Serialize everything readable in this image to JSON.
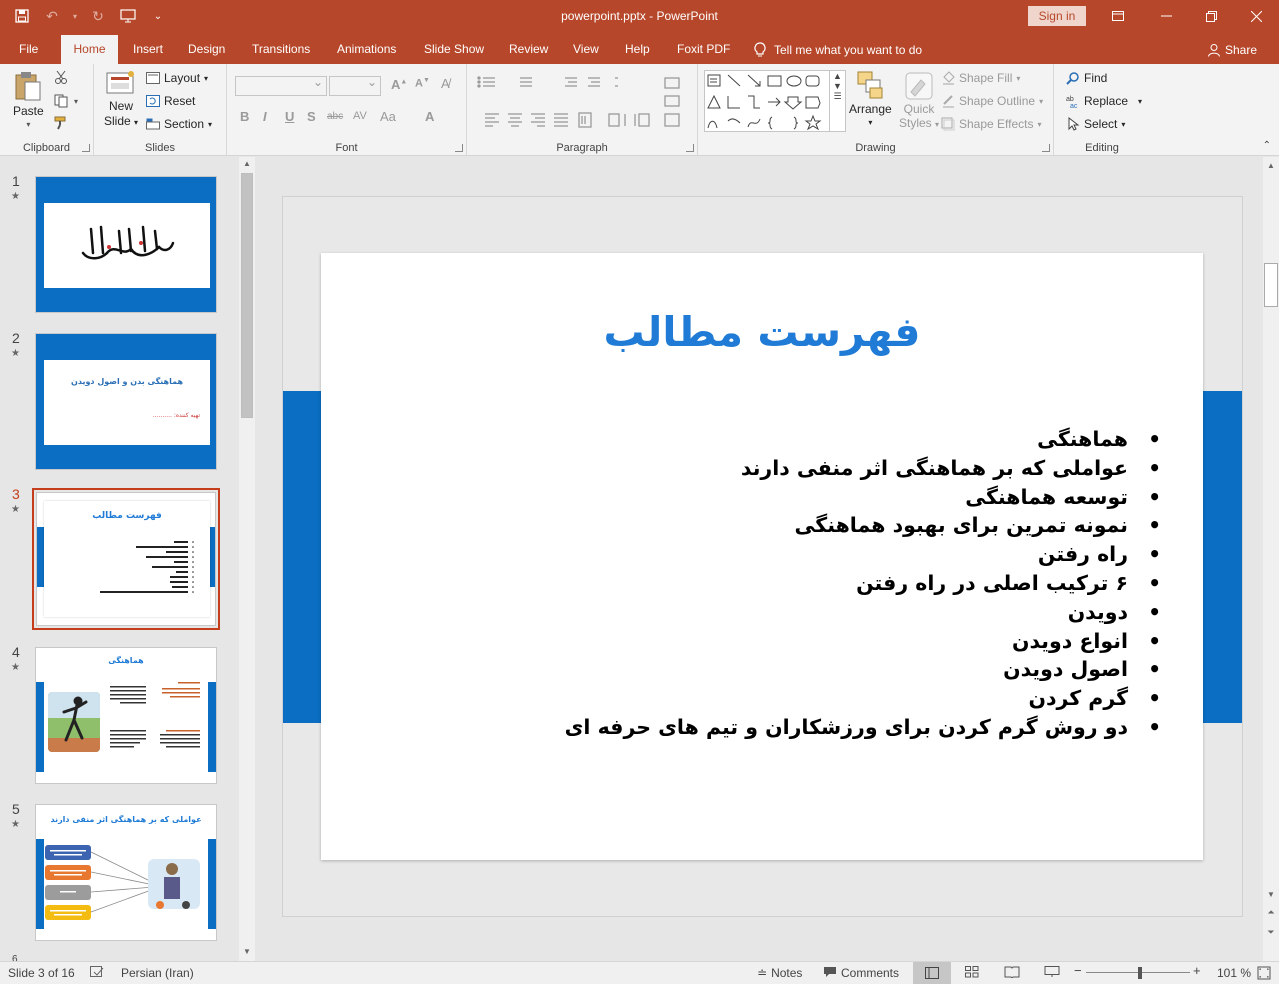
{
  "window": {
    "title": "powerpoint.pptx  -  PowerPoint",
    "sign_in": "Sign in"
  },
  "tabs": [
    "File",
    "Home",
    "Insert",
    "Design",
    "Transitions",
    "Animations",
    "Slide Show",
    "Review",
    "View",
    "Help",
    "Foxit PDF"
  ],
  "active_tab": "Home",
  "tell_me": "Tell me what you want to do",
  "share": "Share",
  "ribbon": {
    "clipboard": {
      "label": "Clipboard",
      "paste": "Paste"
    },
    "slides": {
      "label": "Slides",
      "new_slide_1": "New",
      "new_slide_2": "Slide",
      "layout": "Layout",
      "reset": "Reset",
      "section": "Section"
    },
    "font": {
      "label": "Font"
    },
    "paragraph": {
      "label": "Paragraph"
    },
    "drawing": {
      "label": "Drawing",
      "arrange": "Arrange",
      "quick_styles_1": "Quick",
      "quick_styles_2": "Styles",
      "shape_fill": "Shape Fill",
      "shape_outline": "Shape Outline",
      "shape_effects": "Shape Effects"
    },
    "editing": {
      "label": "Editing",
      "find": "Find",
      "replace": "Replace",
      "select": "Select"
    }
  },
  "thumbnails": [
    {
      "num": "1",
      "star": "★"
    },
    {
      "num": "2",
      "star": "★",
      "title": "هماهنگی بدن و اصول دویدن",
      "author": "تهیه کننده: .........."
    },
    {
      "num": "3",
      "star": "★",
      "title": "فهرست مطالب"
    },
    {
      "num": "4",
      "star": "★",
      "title": "هماهنگی"
    },
    {
      "num": "5",
      "star": "★",
      "title": "عواملی که بر هماهنگی اثر منفی دارند"
    }
  ],
  "slide": {
    "title": "فهرست مطالب",
    "items": [
      "هماهنگی",
      "عواملی که بر هماهنگی اثر منفی دارند",
      "توسعه هماهنگی",
      "نمونه تمرین برای بهبود هماهنگی",
      "راه رفتن",
      "۶ ترکیب اصلی در راه رفتن",
      "دویدن",
      "انواع دویدن",
      "اصول دویدن",
      "گرم کردن",
      "دو روش گرم کردن برای ورزشکاران و تیم های حرفه ای"
    ]
  },
  "status": {
    "slide_info": "Slide 3 of 16",
    "language": "Persian (Iran)",
    "notes": "Notes",
    "comments": "Comments",
    "zoom": "101 %"
  },
  "colors": {
    "accent": "#b7472a",
    "slide_band": "#0b6ec2",
    "title_blue": "#1f7bd6"
  }
}
